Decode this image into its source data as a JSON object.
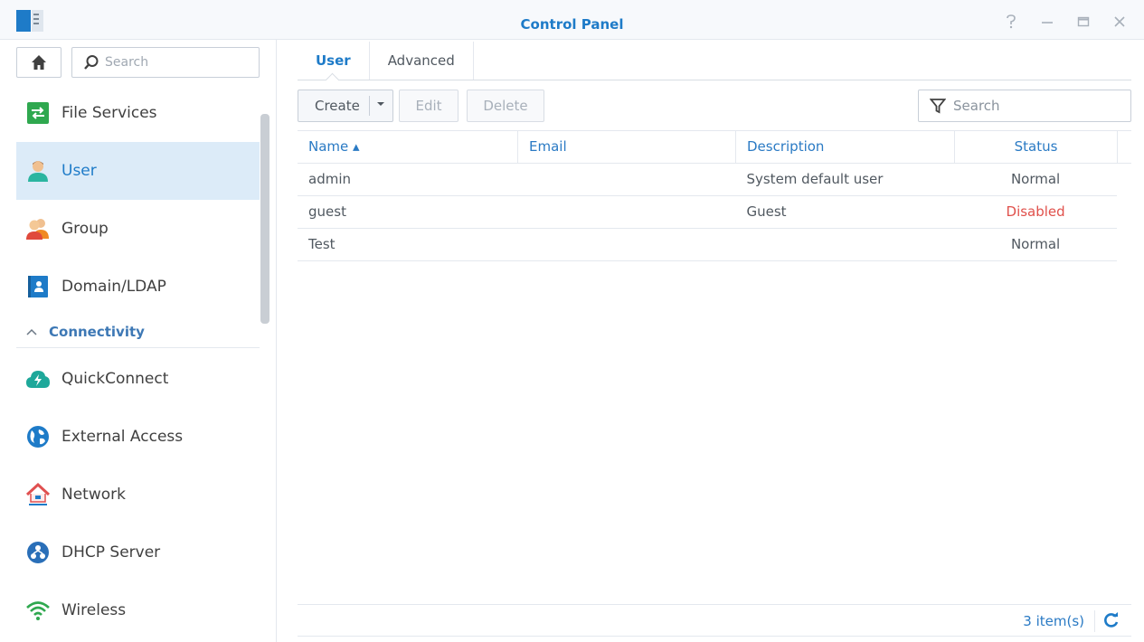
{
  "window": {
    "title": "Control Panel"
  },
  "sidebar": {
    "search_placeholder": "Search",
    "items": [
      {
        "label": "File Services"
      },
      {
        "label": "User"
      },
      {
        "label": "Group"
      },
      {
        "label": "Domain/LDAP"
      }
    ],
    "section": "Connectivity",
    "section_items": [
      {
        "label": "QuickConnect"
      },
      {
        "label": "External Access"
      },
      {
        "label": "Network"
      },
      {
        "label": "DHCP Server"
      },
      {
        "label": "Wireless"
      }
    ]
  },
  "tabs": [
    {
      "label": "User"
    },
    {
      "label": "Advanced"
    }
  ],
  "toolbar": {
    "create_label": "Create",
    "edit_label": "Edit",
    "delete_label": "Delete",
    "search_placeholder": "Search"
  },
  "table": {
    "columns": [
      "Name ▴",
      "Email",
      "Description",
      "Status"
    ],
    "rows": [
      {
        "name": "admin",
        "email": "",
        "description": "System default user",
        "status": "Normal"
      },
      {
        "name": "guest",
        "email": "",
        "description": "Guest",
        "status": "Disabled"
      },
      {
        "name": "Test",
        "email": "",
        "description": "",
        "status": "Normal"
      }
    ]
  },
  "footer": {
    "count": "3 item(s)"
  },
  "colors": {
    "accent": "#1e7bc8",
    "active_bg": "#dcebf8",
    "disabled_status": "#e0504b"
  }
}
